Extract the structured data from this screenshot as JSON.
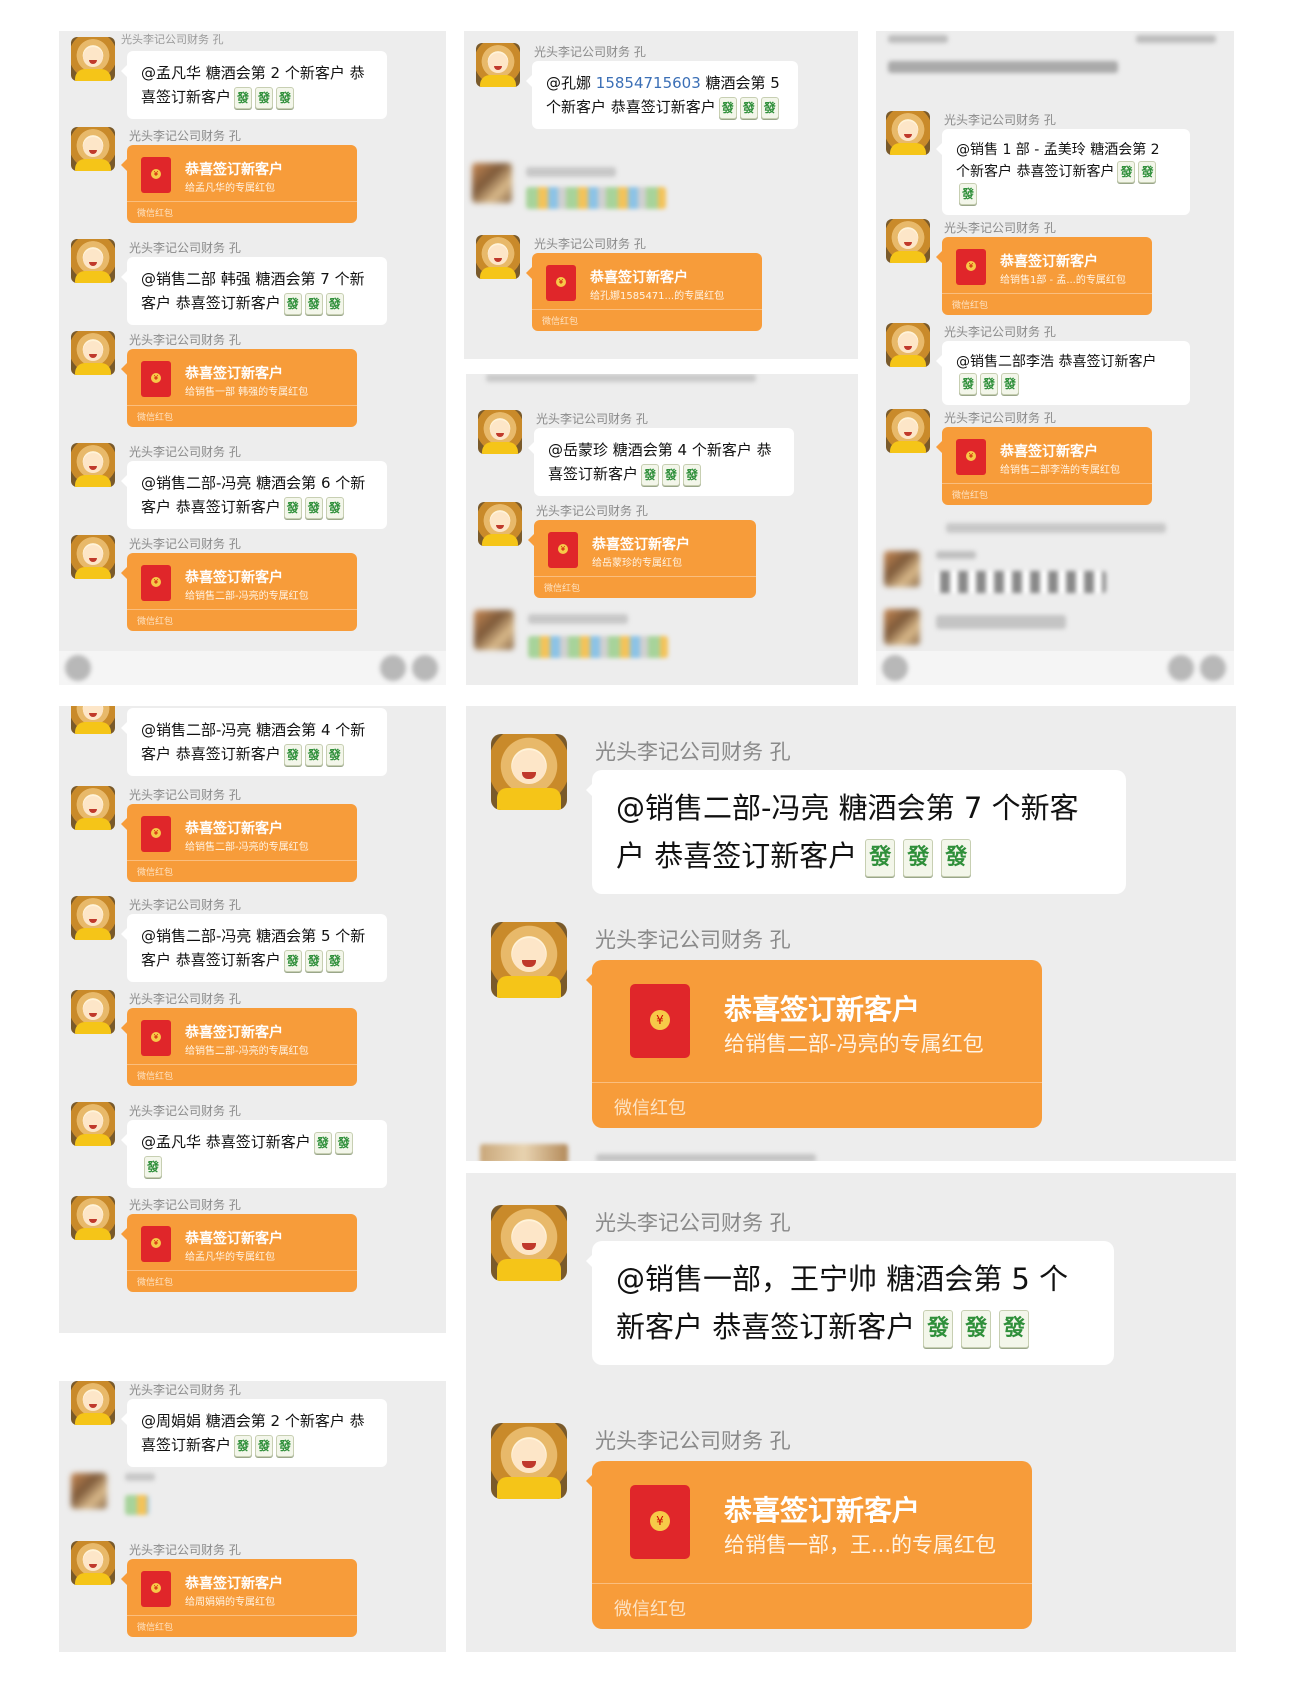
{
  "colors": {
    "panel_bg": "#ededed",
    "bubble_bg": "#ffffff",
    "red_packet": "#f79c3a",
    "envelope": "#e0262a",
    "mention_link": "#3b6fb6"
  },
  "sender": "光头李记公司财务 孔",
  "tile_icon": "發",
  "rp_title": "恭喜签订新客户",
  "rp_footer": "微信红包",
  "panels": {
    "p1": {
      "top_sender": "光头李记公司财务 孔",
      "m1": {
        "text": "@孟凡华  糖酒会第 2 个新客户 恭喜签订新客户"
      },
      "r1": {
        "subtitle": "给孟凡华的专属红包"
      },
      "m2": {
        "text": "@销售二部 韩强  糖酒会第 7 个新客户 恭喜签订新客户"
      },
      "r2": {
        "subtitle": "给销售一部 韩强的专属红包"
      },
      "m3": {
        "text": "@销售二部-冯亮  糖酒会第 6 个新客户 恭喜签订新客户"
      },
      "r3": {
        "subtitle": "给销售二部-冯亮的专属红包"
      }
    },
    "p2": {
      "m1": {
        "mention": "@孔娜 ",
        "number": "15854715603",
        "text": "  糖酒会第 5 个新客户 恭喜签订新客户"
      },
      "r1": {
        "subtitle": "给孔娜1585471...的专属红包"
      }
    },
    "p3": {
      "m1": {
        "text": "@岳蒙珍  糖酒会第 4 个新客户 恭喜签订新客户"
      },
      "r1": {
        "subtitle": "给岳蒙珍的专属红包"
      }
    },
    "p4": {
      "m1": {
        "text": "@销售 1 部 - 孟美玲  糖酒会第 2 个新客户 恭喜签订新客户"
      },
      "r1": {
        "subtitle": "给销售1部 - 孟...的专属红包"
      },
      "m2": {
        "text": "@销售二部李浩  恭喜签订新客户"
      },
      "r2": {
        "subtitle": "给销售二部李浩的专属红包"
      }
    },
    "p5": {
      "m1": {
        "text": "@销售二部-冯亮  糖酒会第 4 个新客户 恭喜签订新客户"
      },
      "r1": {
        "subtitle": "给销售二部-冯亮的专属红包"
      },
      "m2": {
        "text": "@销售二部-冯亮  糖酒会第 5 个新客户 恭喜签订新客户"
      },
      "r2": {
        "subtitle": "给销售二部-冯亮的专属红包"
      },
      "m3": {
        "text": "@孟凡华  恭喜签订新客户"
      },
      "r3": {
        "subtitle": "给孟凡华的专属红包"
      }
    },
    "p6": {
      "m1": {
        "text": "@周娟娟  糖酒会第 2 个新客户 恭喜签订新客户"
      },
      "r1": {
        "subtitle": "给周娟娟的专属红包"
      }
    },
    "p7": {
      "m1": {
        "text": "@销售二部-冯亮  糖酒会第 7 个新客户 恭喜签订新客户"
      },
      "r1": {
        "subtitle": "给销售二部-冯亮的专属红包"
      }
    },
    "p8": {
      "m1": {
        "text": "@销售一部，王宁帅  糖酒会第 5 个新客户 恭喜签订新客户"
      },
      "r1": {
        "subtitle": "给销售一部，王...的专属红包"
      }
    }
  }
}
